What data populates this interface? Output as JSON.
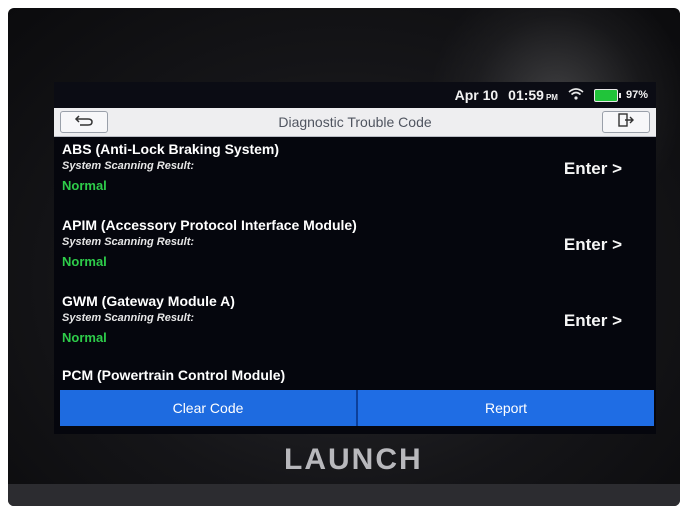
{
  "status_bar": {
    "date": "Apr 10",
    "time": "01:59",
    "ampm": "PM",
    "battery": "97%",
    "wifi_icon": "wifi-icon",
    "battery_icon": "battery-icon"
  },
  "header": {
    "title": "Diagnostic Trouble Code",
    "back_icon": "back-arrow-icon",
    "exit_icon": "exit-icon"
  },
  "modules": [
    {
      "name": "ABS (Anti-Lock Braking System)",
      "subtitle": "System Scanning Result:",
      "status": "Normal",
      "action": "Enter >"
    },
    {
      "name": "APIM (Accessory Protocol Interface Module)",
      "subtitle": "System Scanning Result:",
      "status": "Normal",
      "action": "Enter >"
    },
    {
      "name": "GWM (Gateway Module A)",
      "subtitle": "System Scanning Result:",
      "status": "Normal",
      "action": "Enter >"
    },
    {
      "name": "PCM (Powertrain Control Module)"
    }
  ],
  "actions": {
    "clear": "Clear Code",
    "report": "Report"
  },
  "device": {
    "brand": "LAUNCH"
  },
  "colors": {
    "normal_status": "#2ecc4a",
    "action_button": "#1e6be0",
    "screen_bg": "#05060d"
  }
}
